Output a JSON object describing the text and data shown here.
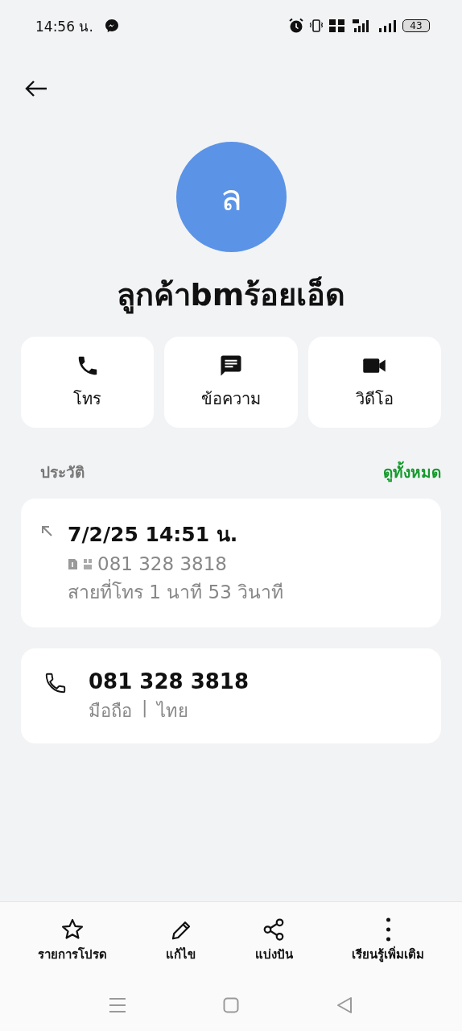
{
  "status_bar": {
    "time": "14:56 น.",
    "battery": "43"
  },
  "contact": {
    "avatar_letter": "ล",
    "name": "ลูกค้าbmร้อยเอ็ด"
  },
  "actions": [
    {
      "kind": "call",
      "label": "โทร"
    },
    {
      "kind": "message",
      "label": "ข้อความ"
    },
    {
      "kind": "video",
      "label": "วิดีโอ"
    }
  ],
  "history": {
    "title": "ประวัติ",
    "see_all": "ดูทั้งหมด",
    "entry": {
      "datetime": "7/2/25 14:51 น.",
      "number": "081 328 3818",
      "duration": "สายที่โทร  1 นาที 53 วินาที"
    }
  },
  "phone": {
    "number": "081 328 3818",
    "type": "มือถือ",
    "separator": "|",
    "region": "ไทย"
  },
  "bottom_actions": [
    {
      "kind": "favorite",
      "label": "รายการโปรด"
    },
    {
      "kind": "edit",
      "label": "แก้ไข"
    },
    {
      "kind": "share",
      "label": "แบ่งปัน"
    },
    {
      "kind": "more",
      "label": "เรียนรู้เพิ่มเติม"
    }
  ]
}
